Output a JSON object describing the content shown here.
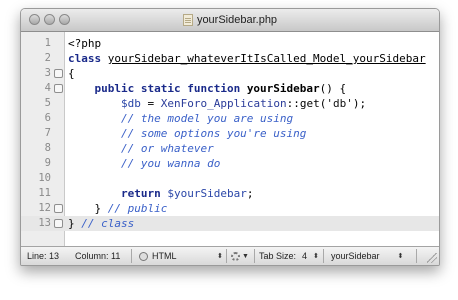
{
  "window": {
    "title": "yourSidebar.php",
    "icon": "php-file-icon"
  },
  "editor": {
    "current_line": 13,
    "lines": [
      {
        "n": "1",
        "tokens": [
          {
            "t": "<?php",
            "c": "plain"
          }
        ]
      },
      {
        "n": "2",
        "tokens": [
          {
            "t": "class ",
            "c": "kw"
          },
          {
            "t": "yourSidebar_whateverItIsCalled_Model_yourSidebar",
            "c": "cls"
          }
        ]
      },
      {
        "n": "3",
        "tokens": [
          {
            "t": "{",
            "c": "plain"
          }
        ],
        "fold": true
      },
      {
        "n": "4",
        "tokens": [
          {
            "t": "    public static function ",
            "c": "kw"
          },
          {
            "t": "yourSidebar",
            "c": "fn"
          },
          {
            "t": "() {",
            "c": "plain"
          }
        ],
        "fold": true
      },
      {
        "n": "5",
        "tokens": [
          {
            "t": "        ",
            "c": "plain"
          },
          {
            "t": "$db",
            "c": "var"
          },
          {
            "t": " = ",
            "c": "plain"
          },
          {
            "t": "XenForo_Application",
            "c": "call"
          },
          {
            "t": "::get(",
            "c": "plain"
          },
          {
            "t": "'db'",
            "c": "str"
          },
          {
            "t": ");",
            "c": "plain"
          }
        ]
      },
      {
        "n": "6",
        "tokens": [
          {
            "t": "        // the model you are using",
            "c": "cmt"
          }
        ]
      },
      {
        "n": "7",
        "tokens": [
          {
            "t": "        // some options you're using",
            "c": "cmt"
          }
        ]
      },
      {
        "n": "8",
        "tokens": [
          {
            "t": "        // or whatever",
            "c": "cmt"
          }
        ]
      },
      {
        "n": "9",
        "tokens": [
          {
            "t": "        // you wanna do",
            "c": "cmt"
          }
        ]
      },
      {
        "n": "10",
        "tokens": []
      },
      {
        "n": "11",
        "tokens": [
          {
            "t": "        ",
            "c": "plain"
          },
          {
            "t": "return ",
            "c": "kw"
          },
          {
            "t": "$yourSidebar",
            "c": "var"
          },
          {
            "t": ";",
            "c": "plain"
          }
        ]
      },
      {
        "n": "12",
        "tokens": [
          {
            "t": "    } ",
            "c": "plain"
          },
          {
            "t": "// public",
            "c": "cmt"
          }
        ],
        "fold": true
      },
      {
        "n": "13",
        "tokens": [
          {
            "t": "} ",
            "c": "plain"
          },
          {
            "t": "// class",
            "c": "cmt"
          }
        ],
        "fold": true
      }
    ]
  },
  "status": {
    "line": "Line: 13",
    "column": "Column: 11",
    "language": "HTML",
    "tab_size_label": "Tab Size:",
    "tab_size_value": "4",
    "symbol": "yourSidebar"
  },
  "colors": {
    "keyword": "#1a2a8a",
    "comment": "#3a60c8",
    "variable": "#2a46a8",
    "gutter": "#ededed",
    "current_line": "#e7e7e7"
  }
}
